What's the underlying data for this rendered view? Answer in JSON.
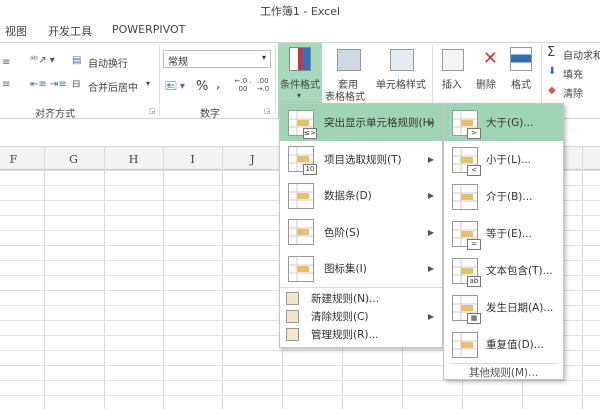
{
  "window": {
    "title": "工作簿1 - Excel"
  },
  "tabs": [
    "视图",
    "开发工具",
    "POWERPIVOT"
  ],
  "ribbon": {
    "alignment": {
      "wrap_text": "自动换行",
      "merge_center": "合并后居中",
      "group_label": "对齐方式"
    },
    "number": {
      "format_value": "常规",
      "percent": "%",
      "comma": ",",
      "inc_decimal": "←.0 .00",
      "dec_decimal": ".00 →.0",
      "group_label": "数字"
    },
    "styles": {
      "conditional_format": "条件格式",
      "table_format_1": "套用",
      "table_format_2": "表格格式",
      "cell_styles": "单元格样式"
    },
    "cells": {
      "insert": "插入",
      "delete": "删除",
      "format": "格式"
    },
    "editing": {
      "autosum": "自动求和",
      "fill": "填充",
      "clear": "清除"
    }
  },
  "columns": [
    "F",
    "G",
    "H",
    "I",
    "J"
  ],
  "cond_menu": {
    "items": [
      {
        "label": "突出显示单元格规则(H)",
        "badge": "≤>",
        "submenu": true
      },
      {
        "label": "项目选取规则(T)",
        "badge": "10",
        "submenu": true
      },
      {
        "label": "数据条(D)",
        "submenu": true
      },
      {
        "label": "色阶(S)",
        "submenu": true
      },
      {
        "label": "图标集(I)",
        "submenu": true
      }
    ],
    "small_items": [
      {
        "label": "新建规则(N)...",
        "submenu": false
      },
      {
        "label": "清除规则(C)",
        "submenu": true
      },
      {
        "label": "管理规则(R)...",
        "submenu": false
      }
    ]
  },
  "highlight_submenu": {
    "items": [
      {
        "label": "大于(G)...",
        "badge": ">"
      },
      {
        "label": "小于(L)...",
        "badge": "<"
      },
      {
        "label": "介于(B)...",
        "badge": ""
      },
      {
        "label": "等于(E)...",
        "badge": "="
      },
      {
        "label": "文本包含(T)...",
        "badge": "ab"
      },
      {
        "label": "发生日期(A)...",
        "badge": "▦"
      },
      {
        "label": "重复值(D)...",
        "badge": ""
      }
    ],
    "more": "其他规则(M)..."
  },
  "colors": {
    "highlight": "#9fd5b5",
    "accent": "#217346"
  }
}
